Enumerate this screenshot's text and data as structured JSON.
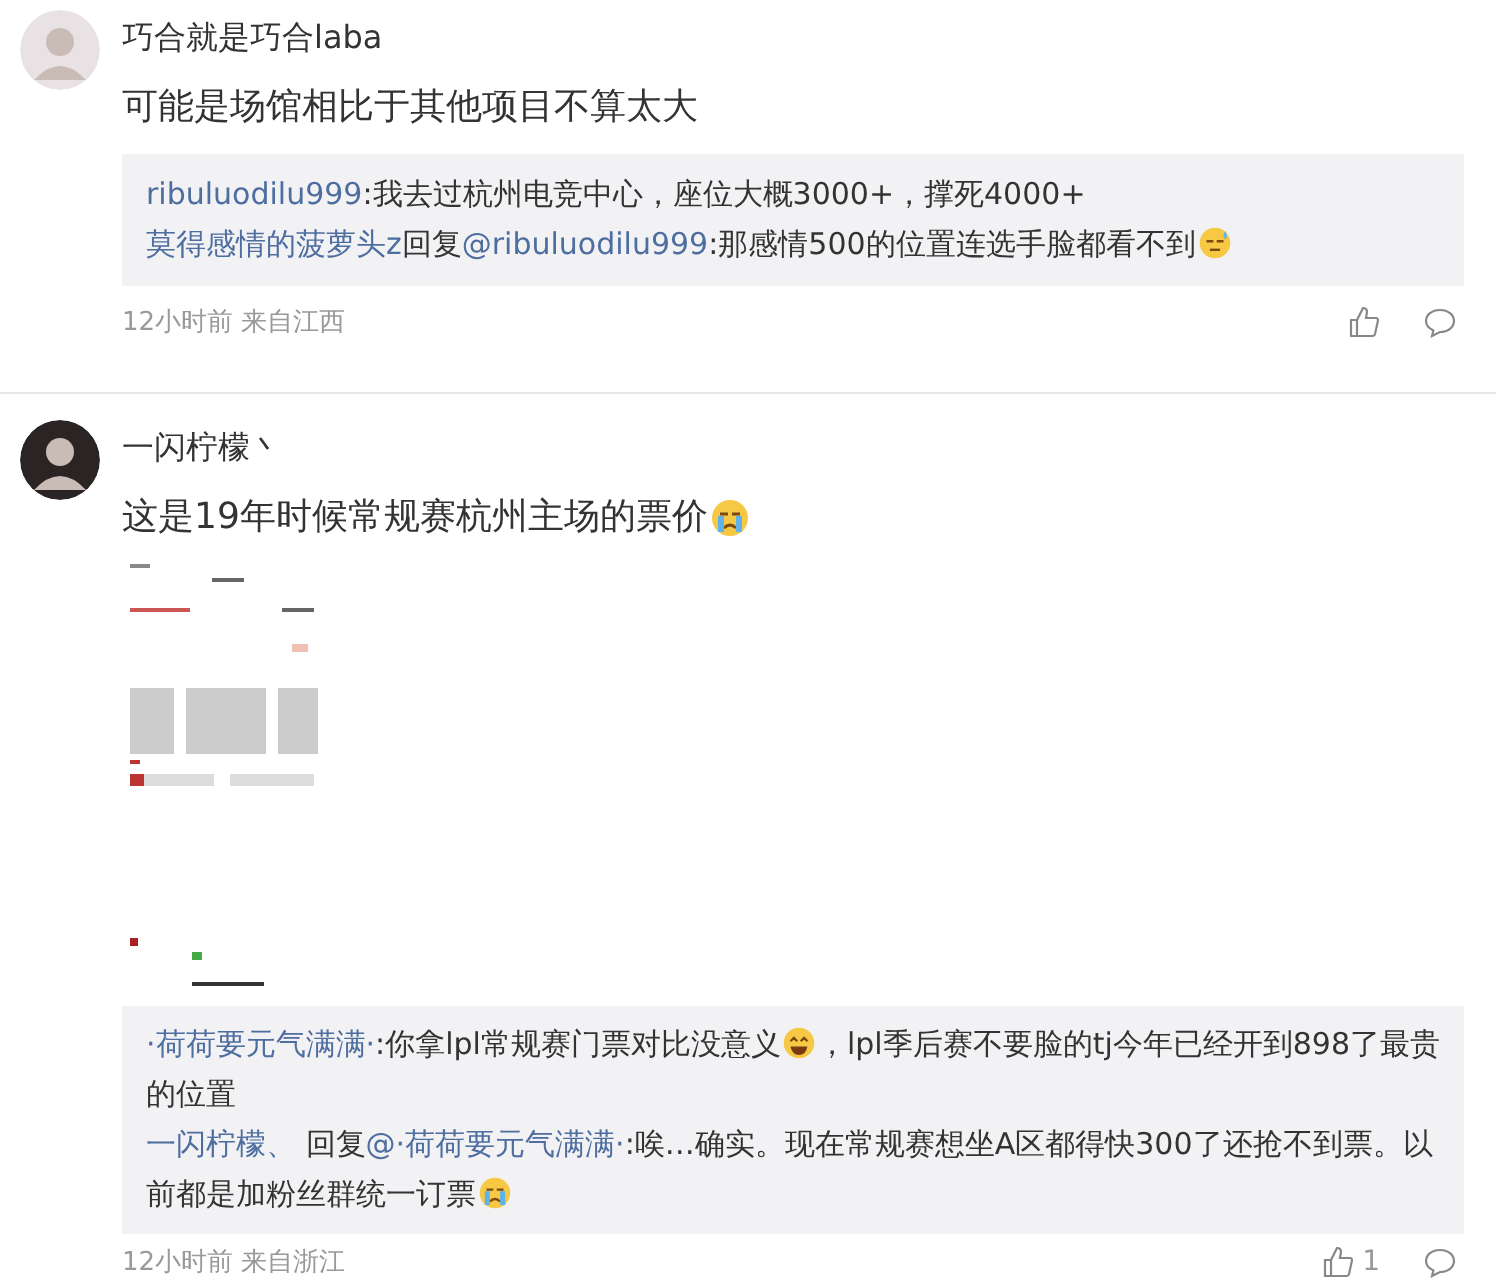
{
  "comments": [
    {
      "user": "巧合就是巧合laba",
      "avatar": {
        "color": "#e8e2e4"
      },
      "text": "可能是场馆相比于其他项目不算太大",
      "replies": [
        {
          "parts": [
            {
              "kind": "link",
              "text": "ribuluodilu999"
            },
            {
              "kind": "text",
              "text": ":我去过杭州电竞中心，座位大概3000+，撑死4000+"
            }
          ]
        },
        {
          "parts": [
            {
              "kind": "link",
              "text": "莫得感情的菠萝头z"
            },
            {
              "kind": "text",
              "text": "回复"
            },
            {
              "kind": "link",
              "text": "@ribuluodilu999"
            },
            {
              "kind": "text",
              "text": ":那感情500的位置连选手脸都看不到"
            },
            {
              "kind": "sweat"
            }
          ]
        }
      ],
      "meta": "12小时前 来自江西"
    },
    {
      "user": "一闪柠檬丶",
      "avatar": {
        "color": "#2a2424"
      },
      "text": "这是19年时候常规赛杭州主场的票价",
      "text_emoji": {
        "kind": "cry"
      },
      "image": {
        "kind": "screenshot"
      },
      "replies": [
        {
          "parts": [
            {
              "kind": "link",
              "text": "·荷荷要元气满满·"
            },
            {
              "kind": "text",
              "text": ":你拿lpl常规赛门票对比没意义"
            },
            {
              "kind": "laugh"
            },
            {
              "kind": "text",
              "text": "，lpl季后赛不要脸的tj今年已经开到898了最贵的位置"
            }
          ]
        },
        {
          "parts": [
            {
              "kind": "link",
              "text": "一闪柠檬、"
            },
            {
              "kind": "text",
              "text": " 回复"
            },
            {
              "kind": "link",
              "text": "@·荷荷要元气满满·"
            },
            {
              "kind": "text",
              "text": ":唉…确实。现在常规赛想坐A区都得快300了还抢不到票。以前都是加粉丝群统一订票"
            },
            {
              "kind": "cry"
            }
          ]
        }
      ],
      "meta": "12小时前 来自浙江",
      "likes": "1"
    }
  ]
}
